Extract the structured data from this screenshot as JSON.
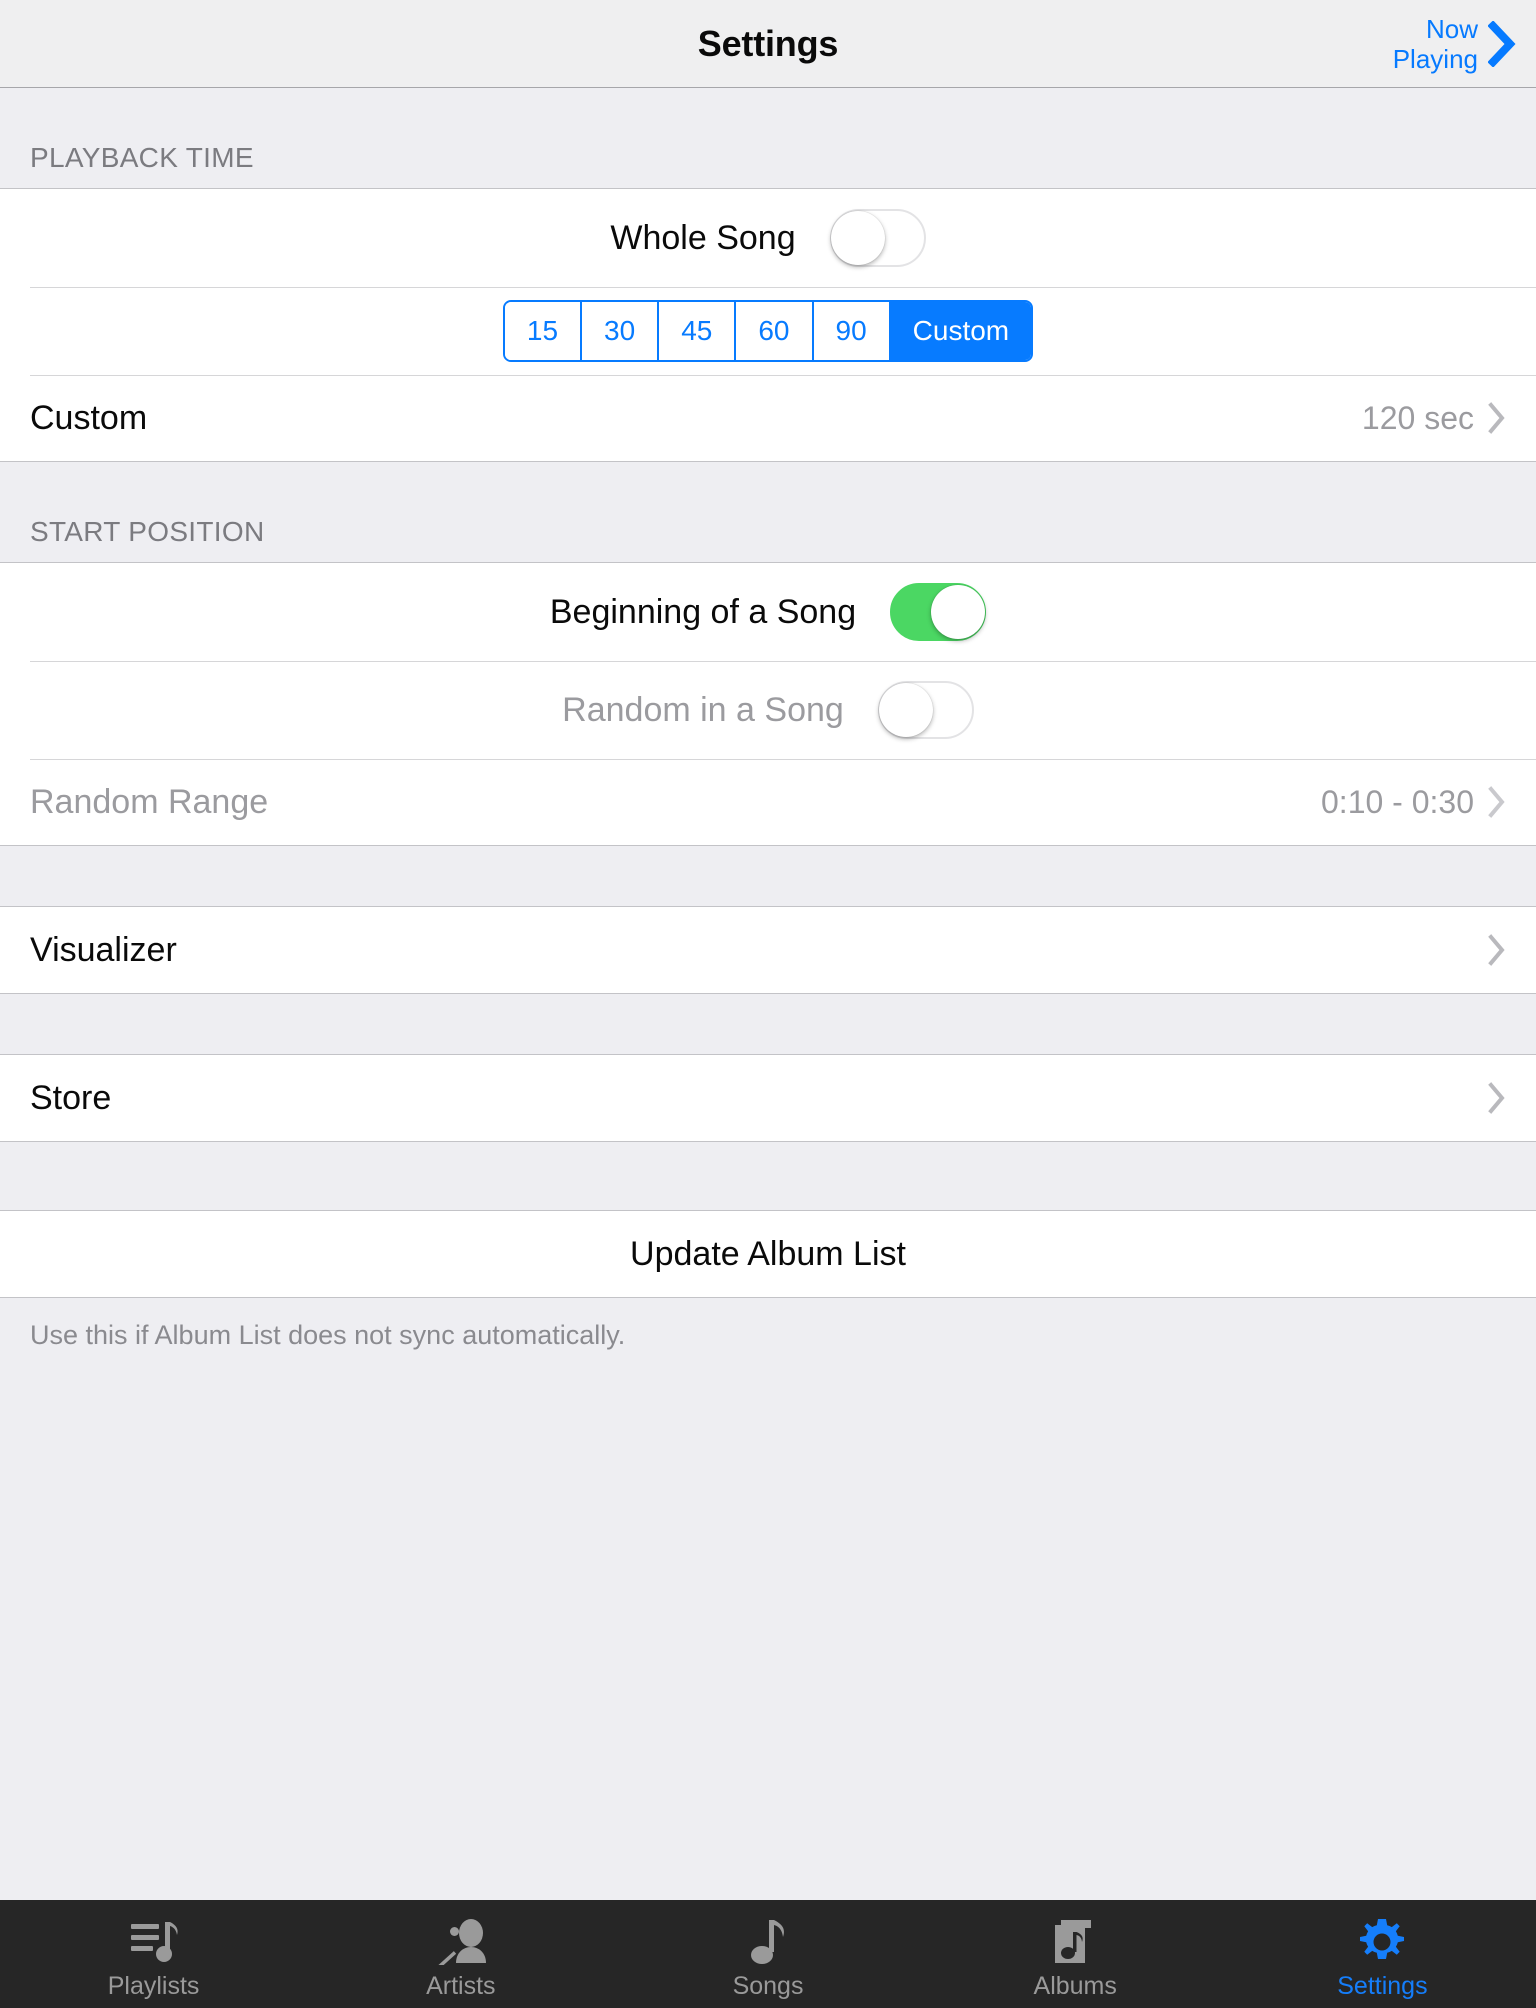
{
  "navbar": {
    "title": "Settings",
    "now_playing_label": "Now\nPlaying",
    "chevron_icon": "chevron-right-icon",
    "accent_color": "#067aff"
  },
  "sections": {
    "playback_time": {
      "header": "PLAYBACK TIME",
      "whole_song": {
        "label": "Whole Song",
        "state": "off"
      },
      "segmented": {
        "options": [
          "15",
          "30",
          "45",
          "60",
          "90",
          "Custom"
        ],
        "selected": "Custom",
        "tint_color": "#077bff"
      },
      "custom_row": {
        "label": "Custom",
        "value": "120 sec",
        "chevron_icon": "chevron-right-icon"
      }
    },
    "start_position": {
      "header": "START POSITION",
      "beginning_of_song": {
        "label": "Beginning of a Song",
        "state": "on",
        "on_color": "#4bd763"
      },
      "random_in_song": {
        "label": "Random in a Song",
        "state": "off"
      },
      "random_range": {
        "label": "Random Range",
        "value": "0:10 - 0:30",
        "chevron_icon": "chevron-right-icon",
        "disabled": true
      }
    },
    "visualizer_row": {
      "label": "Visualizer",
      "chevron_icon": "chevron-right-icon"
    },
    "store_row": {
      "label": "Store",
      "chevron_icon": "chevron-right-icon"
    },
    "update_album": {
      "label": "Update Album List",
      "footer": "Use this if Album List does not sync automatically."
    }
  },
  "tabbar": {
    "background": "#262626",
    "active_color": "#157efb",
    "inactive_color": "#9a9a9a",
    "tabs": [
      {
        "label": "Playlists",
        "icon": "playlist-note-icon",
        "active": false
      },
      {
        "label": "Artists",
        "icon": "microphone-person-icon",
        "active": false
      },
      {
        "label": "Songs",
        "icon": "music-note-icon",
        "active": false
      },
      {
        "label": "Albums",
        "icon": "album-stack-icon",
        "active": false
      },
      {
        "label": "Settings",
        "icon": "gear-icon",
        "active": true
      }
    ]
  }
}
